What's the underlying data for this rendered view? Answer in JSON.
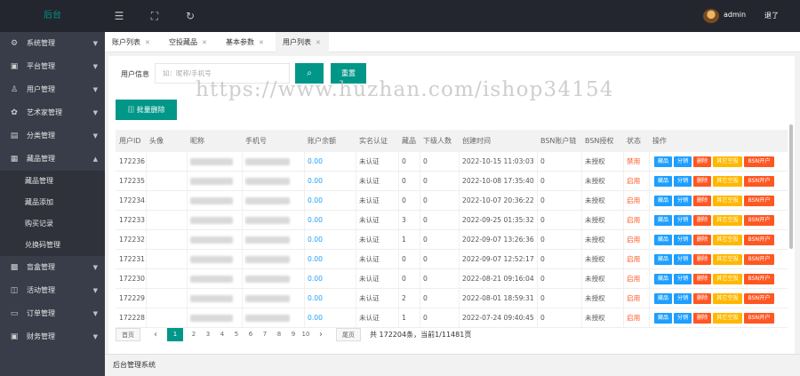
{
  "topbar": {
    "brand": "后台",
    "fold_icon": "menu-fold-icon",
    "fullscreen_icon": "fullscreen-icon",
    "refresh_icon": "refresh-icon",
    "user": "admin",
    "logout": "退了"
  },
  "sidebar": {
    "items": [
      {
        "label": "系统管理",
        "icon": "gear-icon"
      },
      {
        "label": "平台管理",
        "icon": "monitor-icon"
      },
      {
        "label": "用户管理",
        "icon": "user-icon"
      },
      {
        "label": "艺术家管理",
        "icon": "palette-icon"
      },
      {
        "label": "分类管理",
        "icon": "calendar-icon"
      },
      {
        "label": "藏品管理",
        "icon": "grid-icon"
      },
      {
        "label": "盲盒管理",
        "icon": "box-icon"
      },
      {
        "label": "活动管理",
        "icon": "activity-icon"
      },
      {
        "label": "订单管理",
        "icon": "order-icon"
      },
      {
        "label": "财务管理",
        "icon": "finance-icon"
      }
    ],
    "sub_items": [
      "藏品管理",
      "藏品添加",
      "购买记录",
      "兑换码管理"
    ]
  },
  "tabs": [
    {
      "label": "账户列表"
    },
    {
      "label": "空投藏品"
    },
    {
      "label": "基本参数"
    },
    {
      "label": "用户列表"
    }
  ],
  "search": {
    "label": "用户信息",
    "placeholder": "如：昵称/手机号",
    "reset": "重置",
    "batch_delete": "批量删除"
  },
  "watermark": "https://www.huzhan.com/ishop34154",
  "table": {
    "headers": [
      "用户ID",
      "头像",
      "昵称",
      "手机号",
      "账户余额",
      "实名认证",
      "藏品",
      "下级人数",
      "创建时间",
      "BSN账户链",
      "BSN授权",
      "状态",
      "操作"
    ],
    "ops": [
      "藏品",
      "分销",
      "删除",
      "其它空投",
      "BSN开户"
    ],
    "rows": [
      {
        "id": "172236",
        "balance": "0.00",
        "auth": "未认证",
        "items": "0",
        "subs": "0",
        "created": "2022-10-15 11:03:03",
        "bsn": "0",
        "bsn_auth": "未授权",
        "status": "禁用"
      },
      {
        "id": "172235",
        "balance": "0.00",
        "auth": "未认证",
        "items": "0",
        "subs": "0",
        "created": "2022-10-08 17:35:40",
        "bsn": "0",
        "bsn_auth": "未授权",
        "status": "启用"
      },
      {
        "id": "172234",
        "balance": "0.00",
        "auth": "未认证",
        "items": "0",
        "subs": "0",
        "created": "2022-10-07 20:36:22",
        "bsn": "0",
        "bsn_auth": "未授权",
        "status": "启用"
      },
      {
        "id": "172233",
        "balance": "0.00",
        "auth": "未认证",
        "items": "3",
        "subs": "0",
        "created": "2022-09-25 01:35:32",
        "bsn": "0",
        "bsn_auth": "未授权",
        "status": "启用"
      },
      {
        "id": "172232",
        "balance": "0.00",
        "auth": "未认证",
        "items": "1",
        "subs": "0",
        "created": "2022-09-07 13:26:36",
        "bsn": "0",
        "bsn_auth": "未授权",
        "status": "启用"
      },
      {
        "id": "172231",
        "balance": "0.00",
        "auth": "未认证",
        "items": "0",
        "subs": "0",
        "created": "2022-09-07 12:52:17",
        "bsn": "0",
        "bsn_auth": "未授权",
        "status": "启用"
      },
      {
        "id": "172230",
        "balance": "0.00",
        "auth": "未认证",
        "items": "0",
        "subs": "0",
        "created": "2022-08-21 09:16:04",
        "bsn": "0",
        "bsn_auth": "未授权",
        "status": "启用"
      },
      {
        "id": "172229",
        "balance": "0.00",
        "auth": "未认证",
        "items": "2",
        "subs": "0",
        "created": "2022-08-01 18:59:31",
        "bsn": "0",
        "bsn_auth": "未授权",
        "status": "启用"
      },
      {
        "id": "172228",
        "balance": "0.00",
        "auth": "未认证",
        "items": "1",
        "subs": "0",
        "created": "2022-07-24 09:40:45",
        "bsn": "0",
        "bsn_auth": "未授权",
        "status": "启用"
      }
    ]
  },
  "pager": {
    "first": "首页",
    "prev": "‹",
    "pages": [
      "1",
      "2",
      "3",
      "4",
      "5",
      "6",
      "7",
      "8",
      "9",
      "10"
    ],
    "next": "›",
    "last": "尾页",
    "summary": "共 172204条，当前1/11481页"
  },
  "footer": "后台管理系统",
  "colors": {
    "primary": "#009688",
    "sidebar": "#393d49",
    "topbar": "#23262e",
    "link": "#1e9fff",
    "danger": "#ff5722",
    "warn": "#ffb800"
  }
}
